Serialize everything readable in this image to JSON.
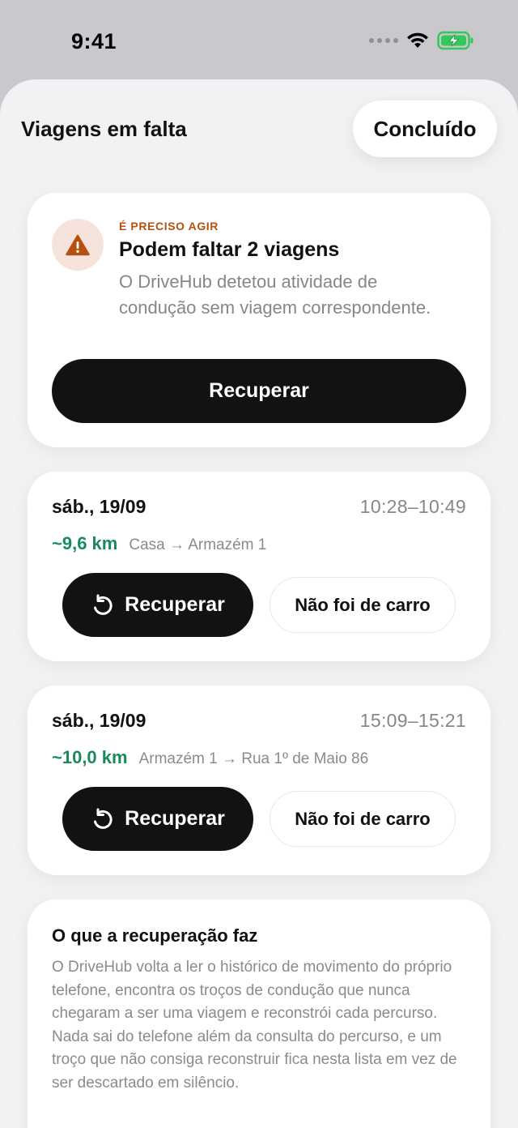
{
  "status_bar": {
    "time": "9:41",
    "icons": [
      "signal-dots-icon",
      "wifi-icon",
      "battery-charging-icon"
    ],
    "battery_color": "#34c759"
  },
  "sheet": {
    "title": "Viagens em falta",
    "done_label": "Concluído"
  },
  "alert": {
    "icon": "warning-triangle-icon",
    "eyebrow": "É PRECISO AGIR",
    "title": "Podem faltar 2 viagens",
    "description": "O DriveHub detetou atividade de condução sem viagem correspondente.",
    "button_label": "Recuperar",
    "accent_color": "#b4510f"
  },
  "trips": [
    {
      "date": "sáb., 19/09",
      "time": "10:28–10:49",
      "distance": "~9,6 km",
      "route": "Casa → Armazém 1",
      "recover_label": "Recuperar",
      "not_car_label": "Não foi de carro"
    },
    {
      "date": "sáb., 19/09",
      "time": "15:09–15:21",
      "distance": "~10,0 km",
      "route": "Armazém 1 → Rua 1º de Maio 86",
      "recover_label": "Recuperar",
      "not_car_label": "Não foi de carro"
    }
  ],
  "info": {
    "title": "O que a recuperação faz",
    "body": "O DriveHub volta a ler o histórico de movimento do próprio telefone, encontra os troços de condução que nunca chegaram a ser uma viagem e reconstrói cada percurso. Nada sai do telefone além da consulta do percurso, e um troço que não consiga reconstruir fica nesta lista em vez de ser descartado em silêncio."
  },
  "colors": {
    "distance_green": "#1a8a5c",
    "primary_dark": "#111214"
  }
}
